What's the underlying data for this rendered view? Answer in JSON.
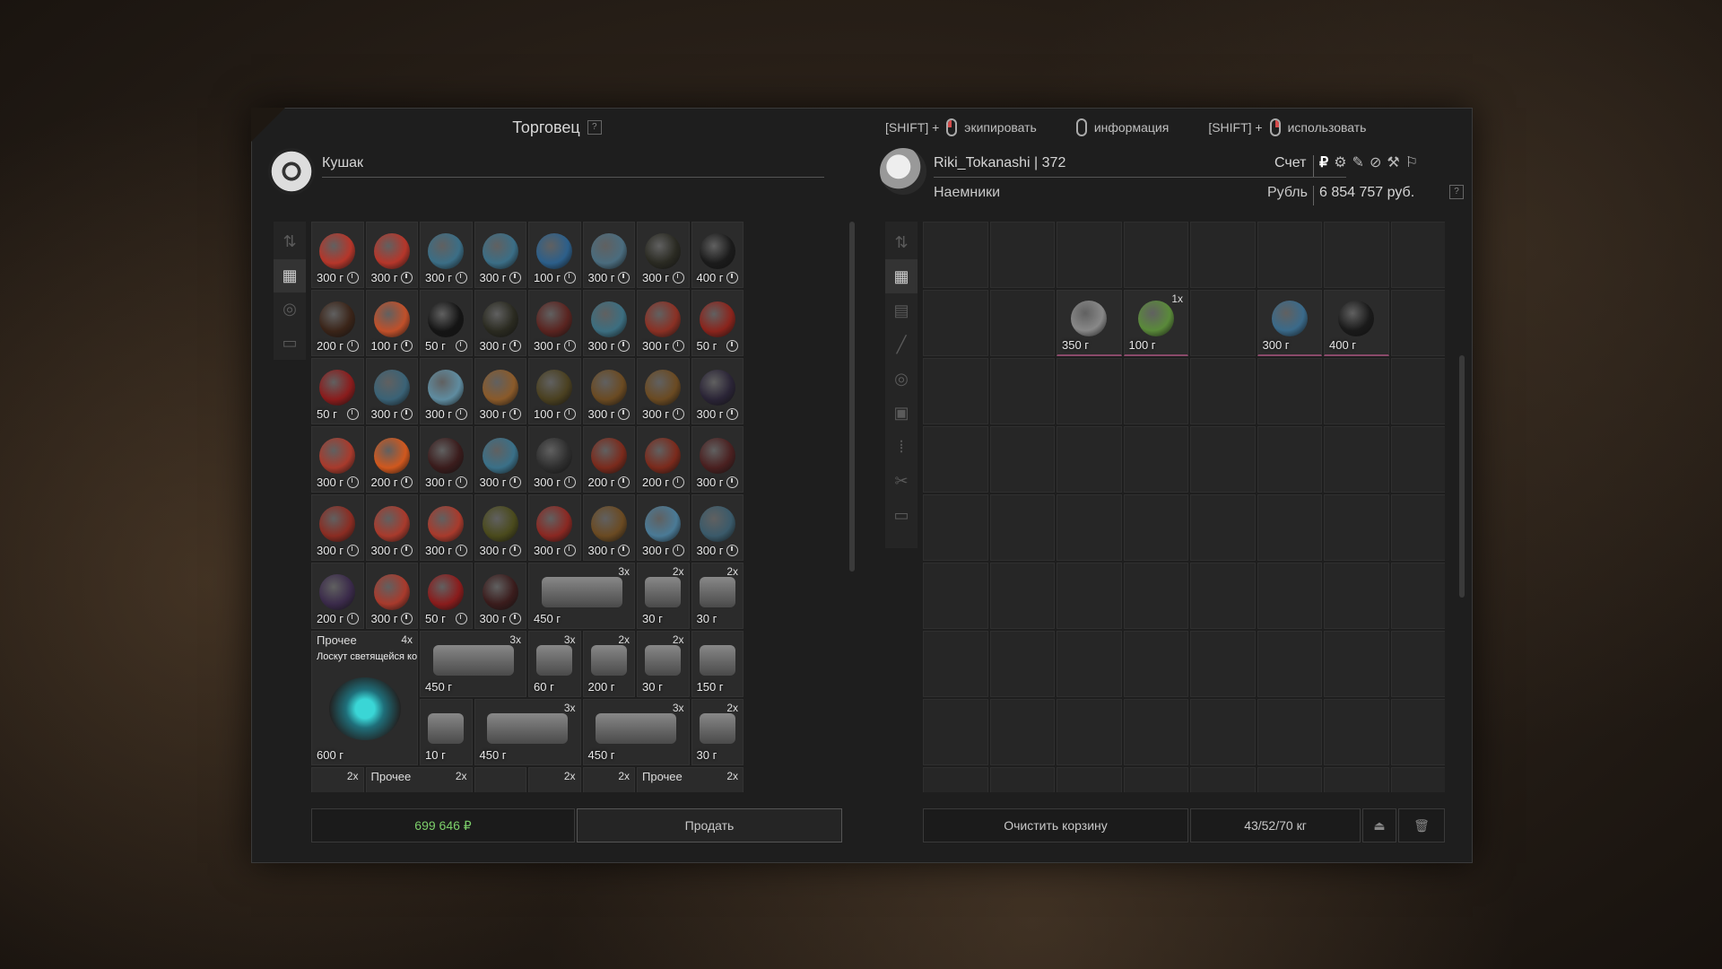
{
  "trader_pane": {
    "title": "Торговец",
    "help": "?",
    "trader_name": "Кушак"
  },
  "hints": [
    {
      "prefix": "[SHIFT] +",
      "mouse": "l",
      "label": "экипировать"
    },
    {
      "prefix": "",
      "mouse": "n",
      "label": "информация"
    },
    {
      "prefix": "[SHIFT] +",
      "mouse": "r",
      "label": "использовать"
    }
  ],
  "player": {
    "name": "Riki_Tokanashi | 372",
    "faction": "Наемники",
    "account_label": "Счет",
    "currency_label": "Рубль",
    "balance": "6 854 757 руб.",
    "currency_icons": [
      "₽",
      "⚙",
      "✎",
      "⊘",
      "⚒",
      "⚐"
    ]
  },
  "colors": {
    "money": "#7ccf6a",
    "accent_red": "#d44b4b"
  },
  "trader_items": [
    {
      "price": "300 г",
      "color": "#b5362a"
    },
    {
      "price": "300 г",
      "color": "#b5362a"
    },
    {
      "price": "300 г",
      "color": "#3b6e86"
    },
    {
      "price": "300 г",
      "color": "#3b6e86"
    },
    {
      "price": "100 г",
      "color": "#2c5f8a"
    },
    {
      "price": "300 г",
      "color": "#4a6c7e"
    },
    {
      "price": "300 г",
      "color": "#2a2a22"
    },
    {
      "price": "400 г",
      "color": "#1b1b1b"
    },
    {
      "price": "200 г",
      "color": "#3a2418"
    },
    {
      "price": "100 г",
      "color": "#c0502a"
    },
    {
      "price": "50 г",
      "color": "#151515"
    },
    {
      "price": "300 г",
      "color": "#2a2a20"
    },
    {
      "price": "300 г",
      "color": "#5a2420"
    },
    {
      "price": "300 г",
      "color": "#3c6e80"
    },
    {
      "price": "300 г",
      "color": "#8a3024"
    },
    {
      "price": "50 г",
      "color": "#8a241c"
    },
    {
      "price": "50 г",
      "color": "#8a1c1c"
    },
    {
      "price": "300 г",
      "color": "#3a6276"
    },
    {
      "price": "300 г",
      "color": "#5f8ca0"
    },
    {
      "price": "300 г",
      "color": "#8a5a2a"
    },
    {
      "price": "100 г",
      "color": "#4a4020"
    },
    {
      "price": "300 г",
      "color": "#6a4a22"
    },
    {
      "price": "300 г",
      "color": "#6a4a22"
    },
    {
      "price": "300 г",
      "color": "#2a2436"
    },
    {
      "price": "300 г",
      "color": "#a83a2c"
    },
    {
      "price": "200 г",
      "color": "#d0581e"
    },
    {
      "price": "300 г",
      "color": "#3a1c1c"
    },
    {
      "price": "300 г",
      "color": "#3a7088"
    },
    {
      "price": "300 г",
      "color": "#2e2e2e"
    },
    {
      "price": "200 г",
      "color": "#7a2a1c"
    },
    {
      "price": "200 г",
      "color": "#7a2a1c"
    },
    {
      "price": "300 г",
      "color": "#4a2020"
    },
    {
      "price": "300 г",
      "color": "#8a2c22"
    },
    {
      "price": "300 г",
      "color": "#a83a2c"
    },
    {
      "price": "300 г",
      "color": "#a83a2c"
    },
    {
      "price": "300 г",
      "color": "#4a4a1c"
    },
    {
      "price": "300 г",
      "color": "#8a2822"
    },
    {
      "price": "300 г",
      "color": "#6a4a22"
    },
    {
      "price": "300 г",
      "color": "#4a7a96"
    },
    {
      "price": "300 г",
      "color": "#3a5a6a"
    },
    {
      "price": "200 г",
      "color": "#3a2a4a"
    },
    {
      "price": "300 г",
      "color": "#a83a2c"
    },
    {
      "price": "50 г",
      "color": "#8a1c1c"
    },
    {
      "price": "300 г",
      "color": "#3a1c1c"
    }
  ],
  "trader_misc": {
    "row6_right": [
      {
        "price": "450 г",
        "qty": "3x"
      },
      {
        "price": "30 г",
        "qty": "2x"
      },
      {
        "price": "30 г",
        "qty": "2x"
      }
    ],
    "big_item": {
      "category": "Прочее",
      "qty": "4x",
      "name": "Лоскут светящейся кож...",
      "price": "600 г"
    },
    "row7": [
      {
        "price": "450 г",
        "qty": "3x"
      },
      {
        "price": "60 г",
        "qty": "3x"
      },
      {
        "price": "200 г",
        "qty": "2x"
      },
      {
        "price": "30 г",
        "qty": "2x"
      },
      {
        "price": "150 г",
        "qty": ""
      }
    ],
    "row8": [
      {
        "price": "10 г",
        "qty": ""
      },
      {
        "price": "450 г",
        "qty": "3x"
      },
      {
        "price": "450 г",
        "qty": "3x"
      },
      {
        "price": "30 г",
        "qty": "2x"
      }
    ],
    "row9": [
      {
        "label": "",
        "qty": "2x"
      },
      {
        "label": "Прочее",
        "qty": "2x"
      },
      {
        "label": "",
        "qty": ""
      },
      {
        "label": "",
        "qty": "2x"
      },
      {
        "label": "",
        "qty": "2x"
      },
      {
        "label": "Прочее",
        "qty": "2x"
      }
    ]
  },
  "cart_items": [
    {
      "price": "350 г",
      "qty": "",
      "color": "#888"
    },
    {
      "price": "100 г",
      "qty": "1x",
      "color": "#5a8a3a"
    },
    {
      "price": "300 г",
      "qty": "",
      "color": "#3a6a8a"
    },
    {
      "price": "400 г",
      "qty": "",
      "color": "#1a1a1a"
    }
  ],
  "footer": {
    "trader_money": "699 646 ₽",
    "sell": "Продать",
    "clear_cart": "Очистить корзину",
    "weight": "43/52/70 кг"
  }
}
